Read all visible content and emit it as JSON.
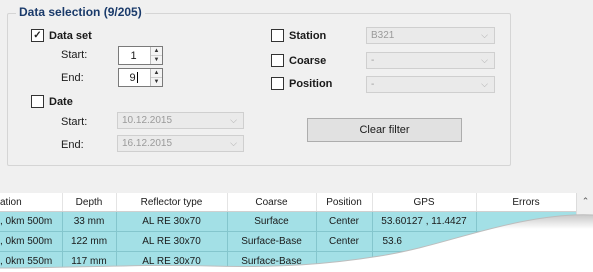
{
  "group_title": "Data selection (9/205)",
  "dataset": {
    "label": "Data set",
    "check_mark": "✓",
    "start_label": "Start:",
    "start_value": "1",
    "end_label": "End:",
    "end_value": "9"
  },
  "date": {
    "label": "Date",
    "start_label": "Start:",
    "start_value": "10.12.2015",
    "end_label": "End:",
    "end_value": "16.12.2015"
  },
  "station": {
    "label": "Station",
    "value": "B321"
  },
  "coarse": {
    "label": "Coarse",
    "value": "-"
  },
  "position": {
    "label": "Position",
    "value": "-"
  },
  "clear_filter": "Clear filter",
  "table": {
    "headers": [
      "ation",
      "Depth",
      "Reflector type",
      "Coarse",
      "Position",
      "GPS",
      "Errors"
    ],
    "rows": [
      [
        ", 0km 500m",
        "33 mm",
        "AL RE 30x70",
        "Surface",
        "Center",
        "53.60127 , 11.4427",
        ""
      ],
      [
        ", 0km 500m",
        "122 mm",
        "AL RE 30x70",
        "Surface-Base",
        "Center",
        "53.6",
        ""
      ],
      [
        ", 0km 550m",
        "117 mm",
        "AL RE 30x70",
        "Surface-Base",
        "",
        "",
        ""
      ]
    ]
  },
  "colors": {
    "row_highlight": "#a3e0e6",
    "title_text": "#1a3a6a"
  },
  "icons": {
    "spin_up": "▲",
    "spin_down": "▼",
    "dropdown": "⌵",
    "scroll_up": "⌃"
  }
}
